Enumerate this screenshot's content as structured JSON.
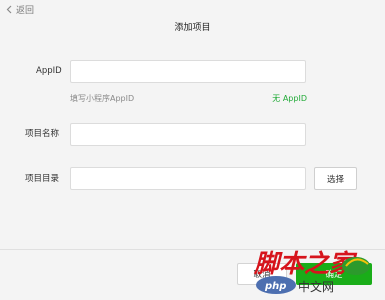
{
  "nav": {
    "back_label": "返回"
  },
  "page": {
    "title": "添加项目"
  },
  "form": {
    "appid": {
      "label": "AppID",
      "value": "",
      "hint": "填写小程序AppID",
      "no_appid_link": "无 AppID"
    },
    "project_name": {
      "label": "项目名称",
      "value": ""
    },
    "project_dir": {
      "label": "项目目录",
      "value": "",
      "select_button": "选择"
    }
  },
  "footer": {
    "cancel_label": "取消",
    "confirm_label": "确定"
  },
  "watermark": {
    "main_text": "脚本之家",
    "sub_text": "php中文网"
  },
  "colors": {
    "accent_green": "#1aad19",
    "link_green": "#22ab38",
    "watermark_red": "#d6141c"
  }
}
